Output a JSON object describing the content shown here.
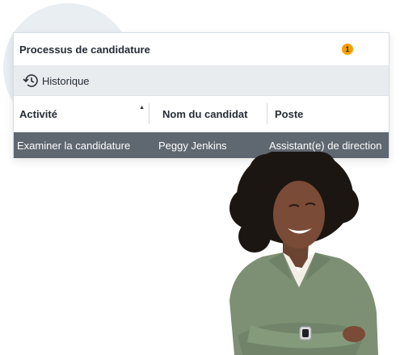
{
  "panel": {
    "title": "Processus de candidature",
    "badge_count": "1",
    "badge_color": "#f5a000"
  },
  "toolbar": {
    "history_label": "Historique",
    "history_icon": "history-icon"
  },
  "table": {
    "columns": [
      "Activité",
      "Nom du candidat",
      "Poste"
    ],
    "rows": [
      [
        "Examiner la candidature",
        "Peggy Jenkins",
        "Assistant(e) de direction"
      ]
    ],
    "selected_row_color": "#5f6770"
  },
  "photo": {
    "subject": "smiling-woman-arms-crossed",
    "shirt_color": "#7d9074"
  }
}
